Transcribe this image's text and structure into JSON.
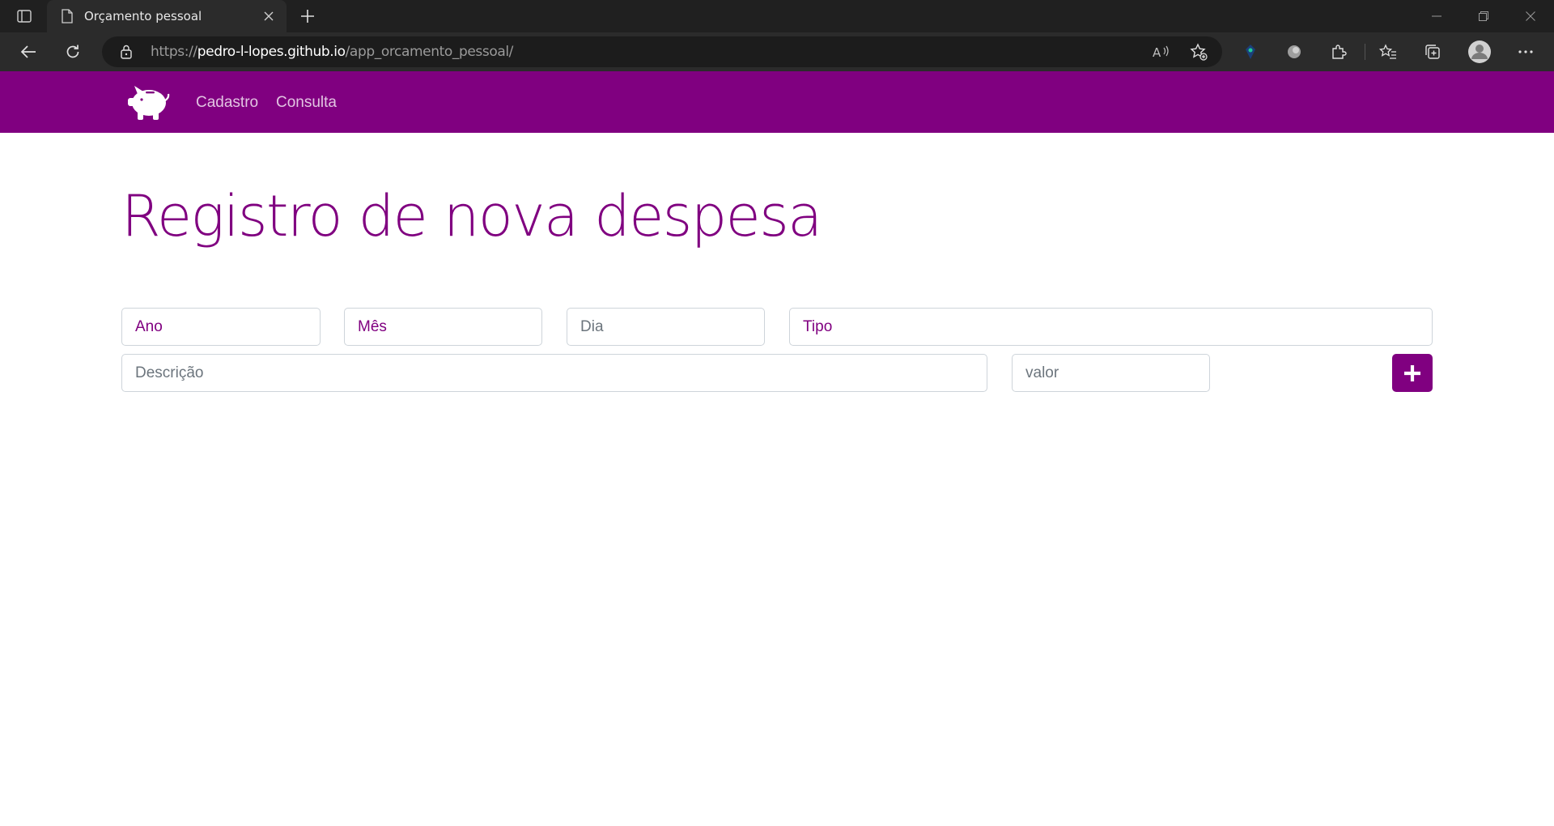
{
  "browser": {
    "tab_title": "Orçamento pessoal",
    "url_scheme": "https://",
    "url_host": "pedro-l-lopes.github.io",
    "url_path": "/app_orcamento_pessoal/"
  },
  "app": {
    "brand_icon": "piggy-bank-icon",
    "nav": {
      "cadastro": "Cadastro",
      "consulta": "Consulta"
    },
    "title": "Registro de nova despesa",
    "form": {
      "ano": "Ano",
      "mes": "Mês",
      "dia": "Dia",
      "tipo": "Tipo",
      "descricao_placeholder": "Descrição",
      "valor_placeholder": "valor",
      "add_icon": "plus-icon"
    },
    "colors": {
      "primary": "#800080",
      "nav_link": "#e2c4e2"
    }
  }
}
